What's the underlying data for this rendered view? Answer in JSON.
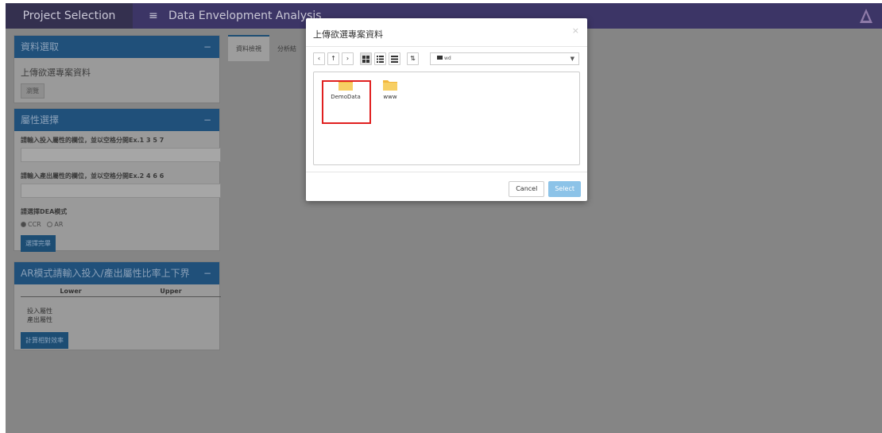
{
  "header": {
    "brand": "Project Selection",
    "menu_icon": "hamburger-icon",
    "app_title": "Data Envelopment Analysis"
  },
  "sidebar": {
    "data_box": {
      "title": "資料選取",
      "collapse": "−",
      "upload_label": "上傳欲選專案資料",
      "browse_button": "瀏覽"
    },
    "attr_box": {
      "title": "屬性選擇",
      "collapse": "−",
      "input_label": "請輸入投入屬性的欄位，並以空格分開Ex.1 3 5 7",
      "output_label": "請輸入產出屬性的欄位，並以空格分開Ex.2 4 6 6",
      "dea_label": "請選擇DEA模式",
      "radio_ccr": "CCR",
      "radio_ar": "AR",
      "select_button": "選擇完畢"
    },
    "ar_box": {
      "title": "AR模式請輸入投入/產出屬性比率上下界",
      "collapse": "−",
      "col_lower": "Lower",
      "col_upper": "Upper",
      "row_input": "投入屬性",
      "row_output": "產出屬性",
      "calc_button": "計算相對效率"
    }
  },
  "tabs": [
    {
      "label": "資料檢視"
    },
    {
      "label": "分析結"
    }
  ],
  "modal": {
    "title": "上傳欲選專案資料",
    "close": "×",
    "toolbar": {
      "back": "‹",
      "up": "↑",
      "forward": "›",
      "sort": "⇅"
    },
    "path": "wd",
    "folders": [
      {
        "name": "DemoData"
      },
      {
        "name": "www"
      }
    ],
    "cancel_button": "Cancel",
    "select_button": "Select"
  },
  "colors": {
    "header_bg": "#3c3566",
    "box_head_bg": "#20507a",
    "highlight": "#e02020",
    "select_btn": "#8cc3e8",
    "folder": "#f5c34f"
  }
}
